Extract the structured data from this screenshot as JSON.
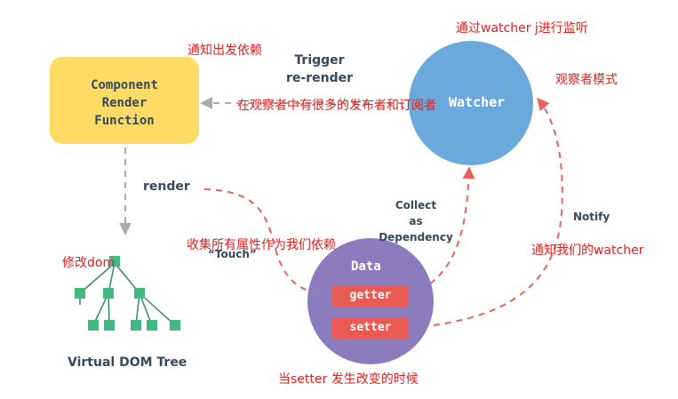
{
  "component": {
    "lines": [
      "Component",
      "Render",
      "Function"
    ]
  },
  "watcher": {
    "label": "Watcher"
  },
  "data_node": {
    "title": "Data",
    "getter": "getter",
    "setter": "setter"
  },
  "edges": {
    "trigger": [
      "Trigger",
      "re-render"
    ],
    "render": "render",
    "touch": "“Touch”",
    "collect": [
      "Collect",
      "as Dependency"
    ],
    "notify": "Notify"
  },
  "dom_tree": {
    "caption": "Virtual DOM Tree"
  },
  "annotations": {
    "notify_update": "通知出发依赖",
    "watch_listen": "通过watcher j进行监听",
    "observer_pattern": "观察者模式",
    "many_publishers": "在观察者中有很多的发布者和订阅者",
    "collect_all": "收集所有属性作为我们依赖",
    "modify_dom": "修改dom",
    "notify_watcher": "通知我们的watcher",
    "setter_changed": "当setter 发生改变的时候"
  },
  "colors": {
    "component_bg": "#fedb65",
    "watcher_bg": "#6ba8dc",
    "data_bg": "#8c7bbd",
    "pill_bg": "#e85a52",
    "dashed_red": "#e6625b",
    "dashed_gray": "#aaaaaa",
    "tree_node": "#42b883",
    "note_text": "#e02020",
    "label_text": "#34495e"
  }
}
